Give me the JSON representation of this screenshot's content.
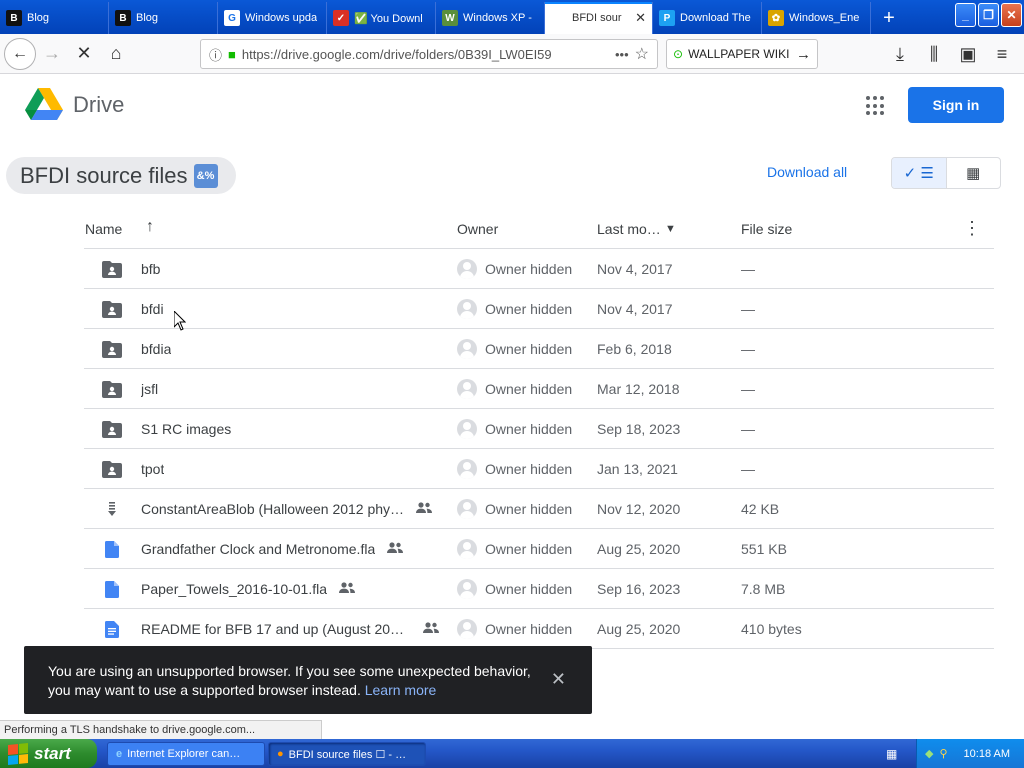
{
  "browser": {
    "tabs": [
      {
        "label": "Blog",
        "icon": "blogger-icon",
        "fav_color": "#111111",
        "fav_text": "B"
      },
      {
        "label": "Blog",
        "icon": "blogger-icon",
        "fav_color": "#111111",
        "fav_text": "B"
      },
      {
        "label": "Windows upda",
        "icon": "google-icon",
        "fav_color": "#ffffff",
        "fav_text": "G"
      },
      {
        "label": "✅ You Downl",
        "icon": "badge-icon",
        "fav_color": "#d93025",
        "fav_text": "✓"
      },
      {
        "label": "Windows XP -",
        "icon": "xp-icon",
        "fav_color": "#5a8f3c",
        "fav_text": "W"
      },
      {
        "label": "BFDI sour",
        "icon": "drive-icon",
        "fav_color": "#ffffff",
        "fav_text": "",
        "active": true
      },
      {
        "label": "Download The",
        "icon": "play-games-icon",
        "fav_color": "#1da1f2",
        "fav_text": "P"
      },
      {
        "label": "Windows_Ene",
        "icon": "flower-icon",
        "fav_color": "#d9a400",
        "fav_text": "✿"
      }
    ],
    "new_tab_glyph": "+",
    "window_buttons": {
      "minimize": "_",
      "restore": "❐",
      "close": "✕"
    },
    "url": "https://drive.google.com/drive/folders/0B39I_LW0EI59",
    "search_value": "WALLPAPER WIKI",
    "page_actions": "•••",
    "icons": {
      "back": "←",
      "forward": "→",
      "stop": "✕",
      "home": "⌂",
      "go": "→",
      "downloads": "⤓",
      "library": "⫼",
      "sidebar": "▣",
      "menu": "≡",
      "info": "ⓘ",
      "lock": "🔒",
      "star": "☆"
    }
  },
  "drive": {
    "product_name": "Drive",
    "sign_in_label": "Sign in",
    "folder_title": "BFDI source files",
    "folder_emoji": "&%",
    "download_all_label": "Download all",
    "view_list_glyph": "✓ ☰",
    "view_grid_glyph": "▦",
    "columns": {
      "name": "Name",
      "name_sort": "↑",
      "owner": "Owner",
      "modified": "Last mo…",
      "modified_sort": "▼",
      "size": "File size",
      "more": "⋮"
    },
    "files": [
      {
        "name": "bfb",
        "type": "shared-folder",
        "shared": false,
        "owner": "Owner hidden",
        "modified": "Nov 4, 2017",
        "size": "—"
      },
      {
        "name": "bfdi",
        "type": "shared-folder",
        "shared": false,
        "owner": "Owner hidden",
        "modified": "Nov 4, 2017",
        "size": "—"
      },
      {
        "name": "bfdia",
        "type": "shared-folder",
        "shared": false,
        "owner": "Owner hidden",
        "modified": "Feb 6, 2018",
        "size": "—"
      },
      {
        "name": "jsfl",
        "type": "shared-folder",
        "shared": false,
        "owner": "Owner hidden",
        "modified": "Mar 12, 2018",
        "size": "—"
      },
      {
        "name": "S1 RC images",
        "type": "shared-folder",
        "shared": false,
        "owner": "Owner hidden",
        "modified": "Sep 18, 2023",
        "size": "—"
      },
      {
        "name": "tpot",
        "type": "shared-folder",
        "shared": false,
        "owner": "Owner hidden",
        "modified": "Jan 13, 2021",
        "size": "—"
      },
      {
        "name": "ConstantAreaBlob (Halloween 2012 phy…",
        "type": "archive",
        "shared": true,
        "owner": "Owner hidden",
        "modified": "Nov 12, 2020",
        "size": "42 KB"
      },
      {
        "name": "Grandfather Clock and Metronome.fla",
        "type": "file",
        "shared": true,
        "owner": "Owner hidden",
        "modified": "Aug 25, 2020",
        "size": "551 KB"
      },
      {
        "name": "Paper_Towels_2016-10-01.fla",
        "type": "file",
        "shared": true,
        "owner": "Owner hidden",
        "modified": "Sep 16, 2023",
        "size": "7.8 MB"
      },
      {
        "name": "README for BFB 17 and up (August 202…",
        "type": "doc",
        "shared": true,
        "owner": "Owner hidden",
        "modified": "Aug 25, 2020",
        "size": "410 bytes"
      }
    ],
    "snackbar": {
      "text": "You are using an unsupported browser. If you see some unexpected behavior, you may want to use a supported browser instead. ",
      "link": "Learn more",
      "close": "✕"
    }
  },
  "status_text": "Performing a TLS handshake to drive.google.com...",
  "taskbar": {
    "start_label": "start",
    "items": [
      {
        "label": "Internet Explorer can…",
        "active": false
      },
      {
        "label": "BFDI source files ☐ - …",
        "active": true
      }
    ],
    "clock": "10:18 AM"
  },
  "colors": {
    "accent": "#1a73e8",
    "xp_blue": "#2457c8",
    "start_green": "#2d8b2d"
  }
}
